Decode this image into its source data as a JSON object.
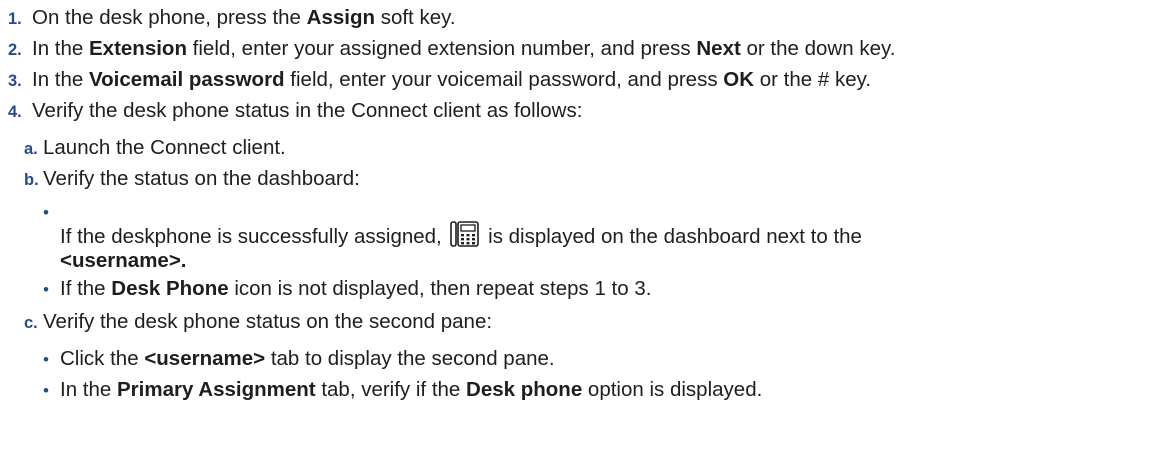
{
  "steps": [
    {
      "num": "1.",
      "parts": [
        "On the desk phone, press the ",
        "Assign",
        " soft key."
      ]
    },
    {
      "num": "2.",
      "parts": [
        "In the ",
        "Extension",
        " field, enter your assigned extension number, and press ",
        "Next",
        " or the down key."
      ]
    },
    {
      "num": "3.",
      "parts": [
        "In the ",
        "Voicemail password",
        " field, enter your voicemail password, and press ",
        "OK",
        " or the # key."
      ]
    },
    {
      "num": "4.",
      "text": "Verify the desk phone status in the Connect client as follows:",
      "substeps": [
        {
          "marker": "a.",
          "text": "Launch the Connect client."
        },
        {
          "marker": "b.",
          "text": "Verify the status on the dashboard:",
          "bullets": [
            {
              "bullet": "•",
              "parts": [
                "If the deskphone is successfully assigned, ",
                " is displayed on the dashboard next to the",
                "<username>."
              ],
              "icon": "desk-phone-icon"
            },
            {
              "bullet": "•",
              "parts": [
                "If the ",
                "Desk Phone",
                " icon is not displayed, then repeat steps 1 to 3."
              ]
            }
          ]
        },
        {
          "marker": "c.",
          "text": "Verify the desk phone status on the second pane:",
          "bullets": [
            {
              "bullet": "•",
              "parts": [
                "Click the ",
                "<username>",
                " tab to display the second pane."
              ]
            },
            {
              "bullet": "•",
              "parts": [
                "In the ",
                "Primary Assignment",
                " tab, verify if the ",
                "Desk phone",
                " option is displayed."
              ]
            }
          ]
        }
      ]
    }
  ],
  "colors": {
    "marker": "#1f4e8c",
    "text": "#1e1e1e"
  }
}
